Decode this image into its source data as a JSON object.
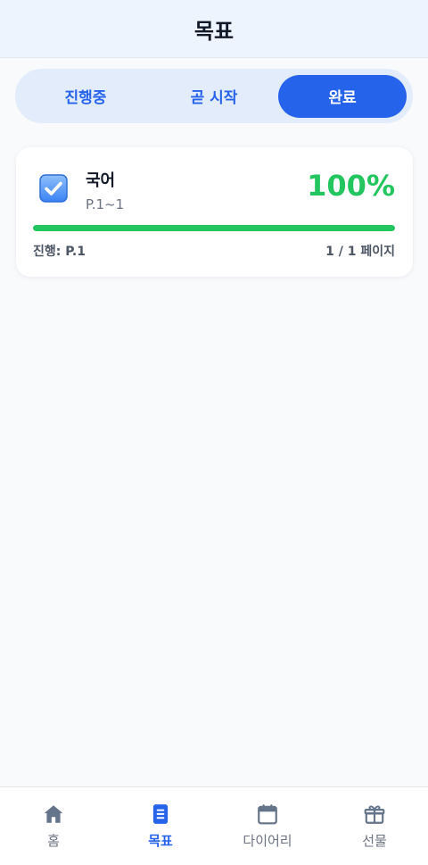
{
  "header": {
    "title": "목표"
  },
  "tabs": [
    {
      "label": "진행중",
      "active": false
    },
    {
      "label": "곧 시작",
      "active": false
    },
    {
      "label": "완료",
      "active": true
    }
  ],
  "goal_card": {
    "subject": "국어",
    "range": "P.1~1",
    "percent_text": "100%",
    "progress": 1.0,
    "current_label": "진행: P.1",
    "pages_label": "1 / 1 페이지",
    "icon": "checkbox-checked-icon"
  },
  "bottom_nav": [
    {
      "label": "홈",
      "icon": "home-icon",
      "active": false
    },
    {
      "label": "목표",
      "icon": "document-icon",
      "active": true
    },
    {
      "label": "다이어리",
      "icon": "calendar-icon",
      "active": false
    },
    {
      "label": "선물",
      "icon": "gift-icon",
      "active": false
    }
  ],
  "colors": {
    "accent": "#2563eb",
    "success": "#22c55e",
    "header_bg": "#eef4fe",
    "tab_bar_bg": "#e3ecfb"
  }
}
